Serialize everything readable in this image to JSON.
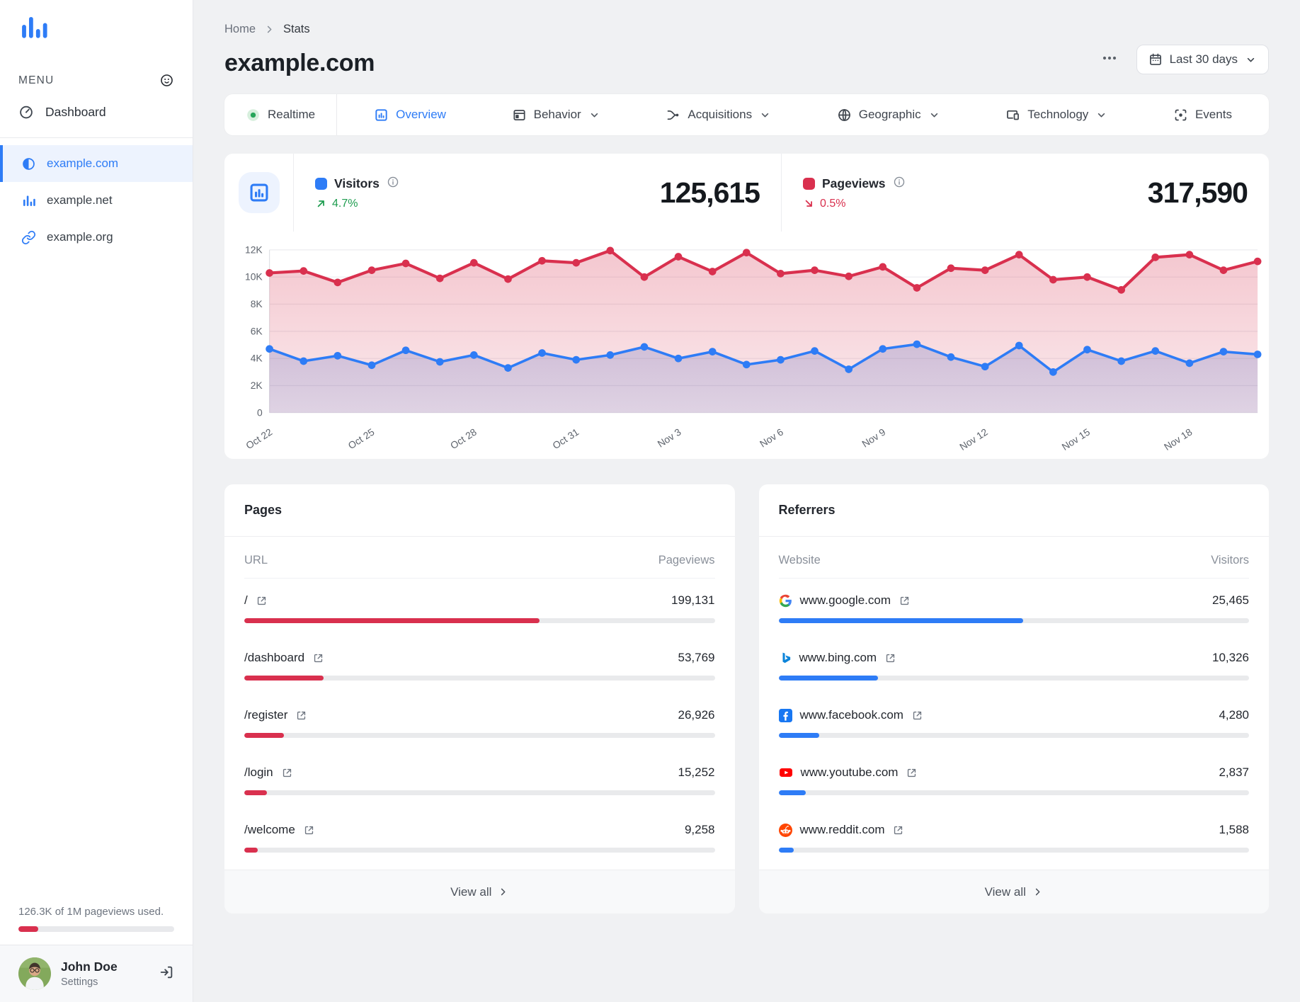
{
  "sidebar": {
    "menu_label": "MENU",
    "nav": [
      {
        "label": "Dashboard",
        "icon": "dashboard"
      }
    ],
    "sites": [
      {
        "label": "example.com",
        "icon": "contrast",
        "active": true
      },
      {
        "label": "example.net",
        "icon": "chart-bars",
        "active": false
      },
      {
        "label": "example.org",
        "icon": "link",
        "active": false
      }
    ],
    "usage": {
      "text": "126.3K of 1M pageviews used.",
      "percent": 12.6,
      "bar_color": "#d9304e"
    },
    "user": {
      "name": "John Doe",
      "subtitle": "Settings"
    }
  },
  "header": {
    "breadcrumb": [
      {
        "label": "Home"
      },
      {
        "label": "Stats"
      }
    ],
    "title": "example.com",
    "date_range_label": "Last 30 days"
  },
  "tabs": [
    {
      "label": "Realtime",
      "icon": "realtime",
      "active": false,
      "chevron": false
    },
    {
      "label": "Overview",
      "icon": "overview",
      "active": true,
      "chevron": false
    },
    {
      "label": "Behavior",
      "icon": "behavior",
      "active": false,
      "chevron": true
    },
    {
      "label": "Acquisitions",
      "icon": "acquisitions",
      "active": false,
      "chevron": true
    },
    {
      "label": "Geographic",
      "icon": "globe",
      "active": false,
      "chevron": true
    },
    {
      "label": "Technology",
      "icon": "technology",
      "active": false,
      "chevron": true
    },
    {
      "label": "Events",
      "icon": "events",
      "active": false,
      "chevron": false
    }
  ],
  "stats": [
    {
      "label": "Visitors",
      "value": "125,615",
      "delta": "4.7%",
      "trend": "up",
      "color": "#2e7cf6"
    },
    {
      "label": "Pageviews",
      "value": "317,590",
      "delta": "0.5%",
      "trend": "down",
      "color": "#d9304e"
    }
  ],
  "chart_data": {
    "type": "area",
    "x": [
      "Oct 22",
      "Oct 23",
      "Oct 24",
      "Oct 25",
      "Oct 26",
      "Oct 27",
      "Oct 28",
      "Oct 29",
      "Oct 30",
      "Oct 31",
      "Nov 1",
      "Nov 2",
      "Nov 3",
      "Nov 4",
      "Nov 5",
      "Nov 6",
      "Nov 7",
      "Nov 8",
      "Nov 9",
      "Nov 10",
      "Nov 11",
      "Nov 12",
      "Nov 13",
      "Nov 14",
      "Nov 15",
      "Nov 16",
      "Nov 17",
      "Nov 18",
      "Nov 19",
      "Nov 20"
    ],
    "x_tick_every": 3,
    "ylim": [
      0,
      12000
    ],
    "yticks": [
      "0",
      "2K",
      "4K",
      "6K",
      "8K",
      "10K",
      "12K"
    ],
    "grid": true,
    "legend_position": "top",
    "series": [
      {
        "name": "Pageviews",
        "color": "#d9304e",
        "values": [
          10300,
          10450,
          9600,
          10500,
          11000,
          9900,
          11050,
          9850,
          11200,
          11050,
          11950,
          10000,
          11500,
          10400,
          11800,
          10250,
          10500,
          10050,
          10750,
          9200,
          10650,
          10500,
          11650,
          9800,
          10000,
          9050,
          11450,
          11650,
          10500,
          11150
        ]
      },
      {
        "name": "Visitors",
        "color": "#2e7cf6",
        "values": [
          4700,
          3800,
          4200,
          3500,
          4600,
          3750,
          4250,
          3300,
          4400,
          3900,
          4250,
          4850,
          4000,
          4500,
          3550,
          3900,
          4550,
          3200,
          4700,
          5050,
          4100,
          3400,
          4950,
          3000,
          4650,
          3800,
          4550,
          3650,
          4500,
          4300
        ]
      }
    ]
  },
  "pages_card": {
    "title": "Pages",
    "columns": [
      "URL",
      "Pageviews"
    ],
    "bar_color": "#d9304e",
    "rows": [
      {
        "label": "/",
        "value": "199,131",
        "bar_pct": 62.7
      },
      {
        "label": "/dashboard",
        "value": "53,769",
        "bar_pct": 16.9
      },
      {
        "label": "/register",
        "value": "26,926",
        "bar_pct": 8.5
      },
      {
        "label": "/login",
        "value": "15,252",
        "bar_pct": 4.8
      },
      {
        "label": "/welcome",
        "value": "9,258",
        "bar_pct": 2.9
      }
    ],
    "view_all_label": "View all"
  },
  "referrers_card": {
    "title": "Referrers",
    "columns": [
      "Website",
      "Visitors"
    ],
    "bar_color": "#2e7cf6",
    "rows": [
      {
        "label": "www.google.com",
        "favicon": "google",
        "value": "25,465",
        "bar_pct": 52.0
      },
      {
        "label": "www.bing.com",
        "favicon": "bing",
        "value": "10,326",
        "bar_pct": 21.1
      },
      {
        "label": "www.facebook.com",
        "favicon": "facebook",
        "value": "4,280",
        "bar_pct": 8.7
      },
      {
        "label": "www.youtube.com",
        "favicon": "youtube",
        "value": "2,837",
        "bar_pct": 5.8
      },
      {
        "label": "www.reddit.com",
        "favicon": "reddit",
        "value": "1,588",
        "bar_pct": 3.2
      }
    ],
    "view_all_label": "View all"
  }
}
